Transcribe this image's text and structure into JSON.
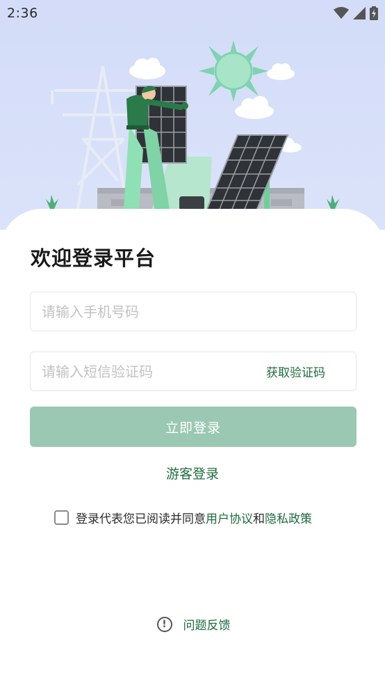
{
  "status_bar": {
    "time": "2:36",
    "icons": [
      "wifi-icon",
      "cellular-signal-icon",
      "battery-charging-icon"
    ]
  },
  "hero": {
    "illustration": "solar-panel-installer-illustration"
  },
  "login": {
    "title": "欢迎登录平台",
    "phone_placeholder": "请输入手机号码",
    "code_placeholder": "请输入短信验证码",
    "get_code_label": "获取验证码",
    "submit_label": "立即登录",
    "guest_label": "游客登录"
  },
  "agreement": {
    "prefix": "登录代表您已阅读并同意",
    "user_agreement": "用户协议",
    "and": "和",
    "privacy_policy": "隐私政策",
    "checked": false
  },
  "footer": {
    "feedback_label": "问题反馈",
    "feedback_icon": "alert-circle-icon"
  },
  "colors": {
    "accent": "#1e6b3e",
    "button": "#9bc8b2",
    "hero_bg": "#d3dcf8"
  }
}
